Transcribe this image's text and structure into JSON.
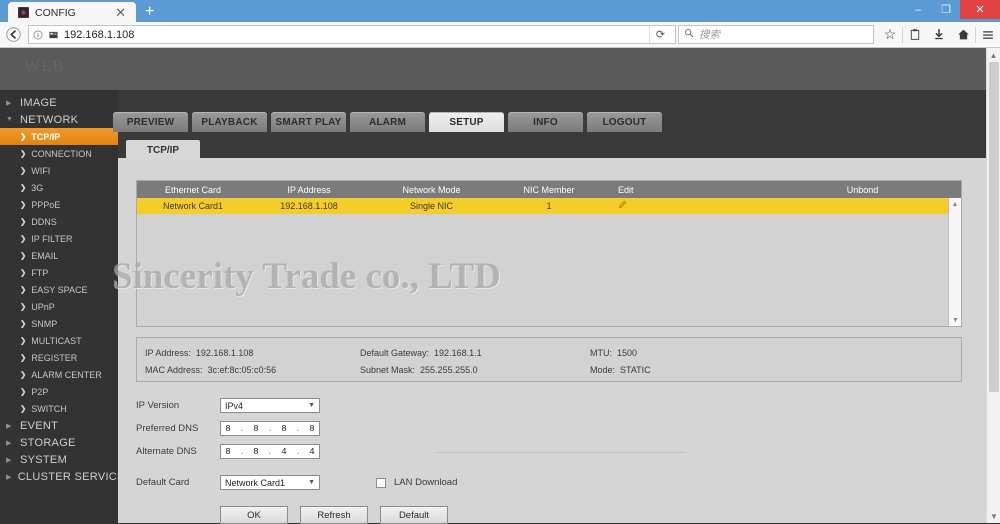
{
  "browser": {
    "tab": {
      "title": "CONFIG",
      "favicon": "camera-icon",
      "close": "✕"
    },
    "new_tab": "+",
    "window": {
      "minimize": "–",
      "maximize": "❐",
      "close": "✕"
    },
    "back": "←",
    "url": "192.168.1.108",
    "url_info_icon": "info-icon",
    "url_shield_icon": "shield-icon",
    "reload": "⟳",
    "search_placeholder": "搜索",
    "search_icon": "search-icon",
    "icons": {
      "bookmark": "☆",
      "reading_list": "▤",
      "download": "⬇",
      "home": "⌂",
      "menu": "≡"
    }
  },
  "app": {
    "logo_text": "WEB",
    "main_tabs": [
      {
        "label": "PREVIEW",
        "active": false
      },
      {
        "label": "PLAYBACK",
        "active": false
      },
      {
        "label": "SMART PLAY",
        "active": false
      },
      {
        "label": "ALARM",
        "active": false
      },
      {
        "label": "SETUP",
        "active": true
      },
      {
        "label": "INFO",
        "active": false
      },
      {
        "label": "LOGOUT",
        "active": false
      }
    ],
    "sub_tabs": [
      {
        "label": "TCP/IP",
        "active": true
      }
    ],
    "watermark": "Sincerity Trade co., LTD",
    "accent_color": "#e4830f",
    "row_highlight_color": "#f5cd2a"
  },
  "sidebar": {
    "groups": [
      {
        "label": "IMAGE",
        "caret": "▶",
        "expanded": false
      },
      {
        "label": "NETWORK",
        "caret": "▼",
        "expanded": true
      }
    ],
    "network_items": [
      {
        "label": "TCP/IP",
        "active": true
      },
      {
        "label": "CONNECTION",
        "active": false
      },
      {
        "label": "WIFI",
        "active": false
      },
      {
        "label": "3G",
        "active": false
      },
      {
        "label": "PPPoE",
        "active": false
      },
      {
        "label": "DDNS",
        "active": false
      },
      {
        "label": "IP FILTER",
        "active": false
      },
      {
        "label": "EMAIL",
        "active": false
      },
      {
        "label": "FTP",
        "active": false
      },
      {
        "label": "EASY SPACE",
        "active": false
      },
      {
        "label": "UPnP",
        "active": false
      },
      {
        "label": "SNMP",
        "active": false
      },
      {
        "label": "MULTICAST",
        "active": false
      },
      {
        "label": "REGISTER",
        "active": false
      },
      {
        "label": "ALARM CENTER",
        "active": false
      },
      {
        "label": "P2P",
        "active": false
      },
      {
        "label": "SWITCH",
        "active": false
      }
    ],
    "bottom_groups": [
      {
        "label": "EVENT",
        "caret": "▶"
      },
      {
        "label": "STORAGE",
        "caret": "▶"
      },
      {
        "label": "SYSTEM",
        "caret": "▶"
      },
      {
        "label": "CLUSTER SERVICE",
        "caret": "▶"
      }
    ],
    "item_chevron": "❯"
  },
  "table": {
    "columns": [
      "Ethernet Card",
      "IP Address",
      "Network Mode",
      "NIC Member",
      "Edit",
      "Unbond"
    ],
    "rows": [
      {
        "ethernet_card": "Network Card1",
        "ip_address": "192.168.1.108",
        "network_mode": "Single NIC",
        "nic_member": "1",
        "edit_icon": "pencil-icon",
        "unbond": ""
      }
    ],
    "scroll_up": "▲",
    "scroll_down": "▼"
  },
  "info": {
    "ip_address_label": "IP Address:",
    "ip_address_value": "192.168.1.108",
    "gateway_label": "Default Gateway:",
    "gateway_value": "192.168.1.1",
    "mtu_label": "MTU:",
    "mtu_value": "1500",
    "mac_label": "MAC Address:",
    "mac_value": "3c:ef:8c:05:c0:56",
    "subnet_label": "Subnet Mask:",
    "subnet_value": "255.255.255.0",
    "mode_label": "Mode:",
    "mode_value": "STATIC"
  },
  "form": {
    "ip_version_label": "IP Version",
    "ip_version_value": "IPv4",
    "preferred_dns_label": "Preferred DNS",
    "preferred_dns": [
      "8",
      "8",
      "8",
      "8"
    ],
    "alternate_dns_label": "Alternate DNS",
    "alternate_dns": [
      "8",
      "8",
      "4",
      "4"
    ],
    "default_card_label": "Default Card",
    "default_card_value": "Network Card1",
    "lan_download_label": "LAN Download",
    "lan_download_checked": false,
    "buttons": [
      {
        "label": "OK"
      },
      {
        "label": "Refresh"
      },
      {
        "label": "Default"
      }
    ],
    "dropdown_caret": "▼",
    "ip_dot": "."
  }
}
